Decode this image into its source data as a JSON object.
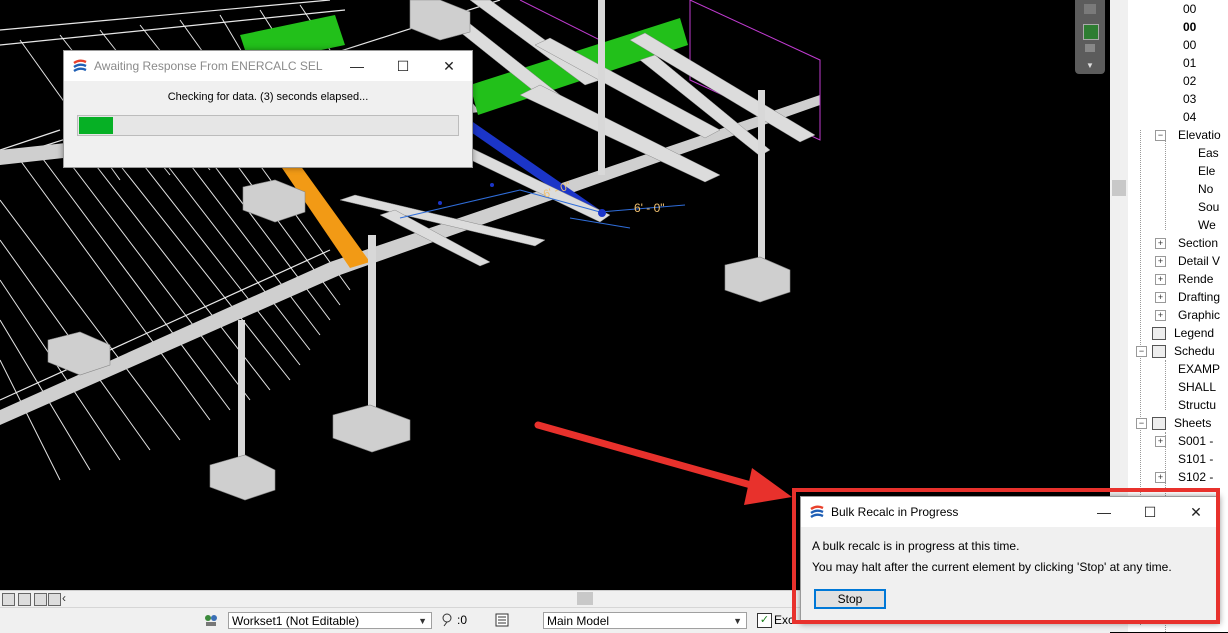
{
  "await_dialog": {
    "title": "Awaiting Response From ENERCALC SEL",
    "message": "Checking for data.  (3) seconds elapsed...",
    "progress_fraction": 0.09,
    "progress_color": "#06b025",
    "minimize_glyph": "—",
    "maximize_glyph": "☐",
    "close_glyph": "✕"
  },
  "bulk_dialog": {
    "title": "Bulk Recalc in Progress",
    "line1": "A bulk recalc is in progress at this time.",
    "line2": "You may halt after the current element by clicking 'Stop' at any time.",
    "stop_label": "Stop",
    "minimize_glyph": "—",
    "maximize_glyph": "☐",
    "close_glyph": "✕"
  },
  "annotation": {
    "highlight_color": "#e8312c"
  },
  "model_dimensions": {
    "dim1": "6' - 0\"",
    "dim2": "6' - 0\""
  },
  "project_browser": {
    "items": [
      {
        "label": "00",
        "bold": false
      },
      {
        "label": "00",
        "bold": true
      },
      {
        "label": "00",
        "bold": false
      },
      {
        "label": "01",
        "bold": false
      },
      {
        "label": "02",
        "bold": false
      },
      {
        "label": "03",
        "bold": false
      },
      {
        "label": "04",
        "bold": false
      },
      {
        "label": "Elevatio",
        "bold": false
      },
      {
        "label": "Eas",
        "bold": false
      },
      {
        "label": "Ele",
        "bold": false
      },
      {
        "label": "No",
        "bold": false
      },
      {
        "label": "Sou",
        "bold": false
      },
      {
        "label": "We",
        "bold": false
      },
      {
        "label": "Section",
        "bold": false
      },
      {
        "label": "Detail V",
        "bold": false
      },
      {
        "label": "Rende",
        "bold": false
      },
      {
        "label": "Drafting",
        "bold": false
      },
      {
        "label": "Graphic",
        "bold": false
      },
      {
        "label": "Legend",
        "bold": false
      },
      {
        "label": "Schedu",
        "bold": false
      },
      {
        "label": "EXAMP",
        "bold": false
      },
      {
        "label": "SHALL",
        "bold": false
      },
      {
        "label": "Structu",
        "bold": false
      },
      {
        "label": "Sheets",
        "bold": false
      },
      {
        "label": "S001 -",
        "bold": false
      },
      {
        "label": "S101 -",
        "bold": false
      },
      {
        "label": "S102 -",
        "bold": false
      }
    ]
  },
  "statusbar": {
    "workset": "Workset1 (Not Editable)",
    "editable_count": ":0",
    "design_option": "Main Model",
    "exclude_label": "Exc"
  },
  "icons": {
    "worksets": "worksets-icon",
    "editable": "editable-requests-icon",
    "design_options": "design-options-icon",
    "enercalc_logo": "enercalc-logo-icon"
  }
}
